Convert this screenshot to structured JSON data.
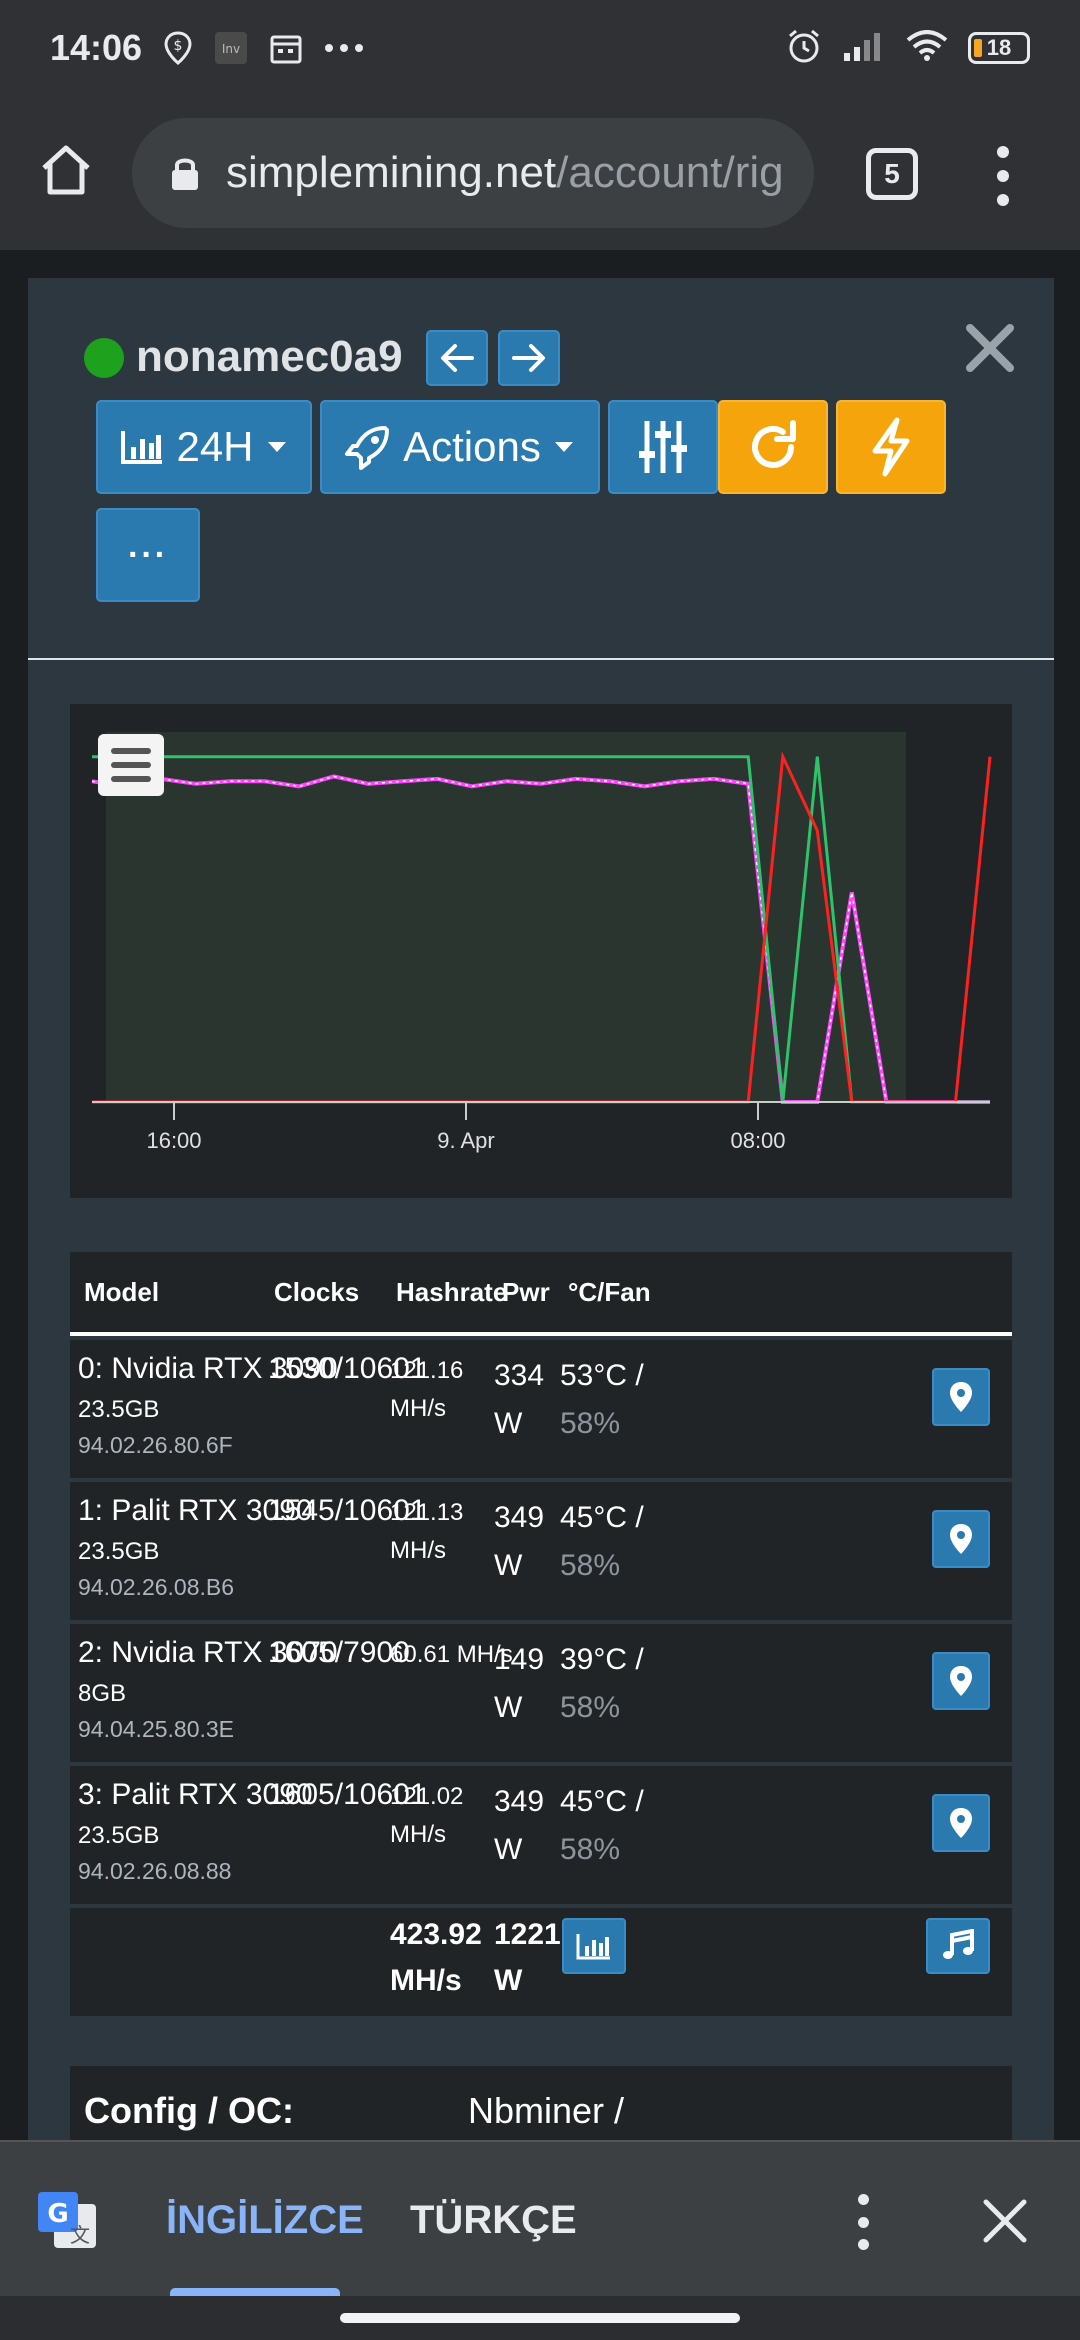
{
  "status_bar": {
    "time": "14:06",
    "battery": "18"
  },
  "browser": {
    "url_domain": "simplemining.net",
    "url_path": "/account/rig",
    "tab_count": "5"
  },
  "rig": {
    "name": "nonamec0a9",
    "status_color": "#1ea21e"
  },
  "toolbar": {
    "period_label": "24H",
    "actions_label": "Actions",
    "more_label": "···"
  },
  "chart_data": {
    "type": "line",
    "x_ticks": [
      "16:00",
      "9. Apr",
      "08:00"
    ],
    "series": [
      {
        "color": "#ff44ff",
        "values": [
          130,
          128,
          131,
          129,
          130,
          130,
          128,
          132,
          129,
          130,
          131,
          128,
          130,
          129,
          131,
          130,
          128,
          130,
          131,
          129,
          0,
          0,
          85,
          0,
          0,
          0,
          0
        ]
      },
      {
        "color": "#2ec26a",
        "values": [
          140,
          140,
          140,
          140,
          140,
          140,
          140,
          140,
          140,
          140,
          140,
          140,
          140,
          140,
          140,
          140,
          140,
          140,
          140,
          140,
          0,
          140,
          0,
          0,
          0,
          0,
          0
        ]
      },
      {
        "color": "#ff2020",
        "values": [
          0,
          0,
          0,
          0,
          0,
          0,
          0,
          0,
          0,
          0,
          0,
          0,
          0,
          0,
          0,
          0,
          0,
          0,
          0,
          0,
          140,
          110,
          0,
          0,
          0,
          0,
          140
        ]
      }
    ]
  },
  "table": {
    "headers": [
      "Model",
      "Clocks",
      "Hashrate",
      "Pwr",
      "°C/Fan"
    ],
    "rows": [
      {
        "model": "0: Nvidia RTX 3090",
        "mem": "23.5GB",
        "bios": "94.02.26.80.6F",
        "clocks": "1530/10601",
        "hash1": "121.16",
        "hash2": "MH/s",
        "pwr1": "334",
        "pwr2": "W",
        "temp": "53°C /",
        "fan": "58%"
      },
      {
        "model": "1: Palit RTX 3090",
        "mem": "23.5GB",
        "bios": "94.02.26.08.B6",
        "clocks": "1545/10601",
        "hash1": "121.13",
        "hash2": "MH/s",
        "pwr1": "349",
        "pwr2": "W",
        "temp": "45°C /",
        "fan": "58%"
      },
      {
        "model": "2: Nvidia RTX 3070",
        "mem": "8GB",
        "bios": "94.04.25.80.3E",
        "clocks": "1605/7900",
        "hash1": "60.61 MH/s",
        "hash2": "",
        "pwr1": "149",
        "pwr2": "W",
        "temp": "39°C /",
        "fan": "58%"
      },
      {
        "model": "3: Palit RTX 3090",
        "mem": "23.5GB",
        "bios": "94.02.26.08.88",
        "clocks": "1605/10601",
        "hash1": "121.02",
        "hash2": "MH/s",
        "pwr1": "349",
        "pwr2": "W",
        "temp": "45°C /",
        "fan": "58%"
      }
    ],
    "total": {
      "hash1": "423.92",
      "hash2": "MH/s",
      "pwr1": "1221",
      "pwr2": "W"
    }
  },
  "config": {
    "label": "Config / OC:",
    "value": "Nbminer /"
  },
  "translate": {
    "lang_from": "İNGİLİZCE",
    "lang_to": "TÜRKÇE"
  },
  "colors": {
    "accent_blue": "#2a7ab0",
    "accent_orange": "#f5a40c"
  }
}
